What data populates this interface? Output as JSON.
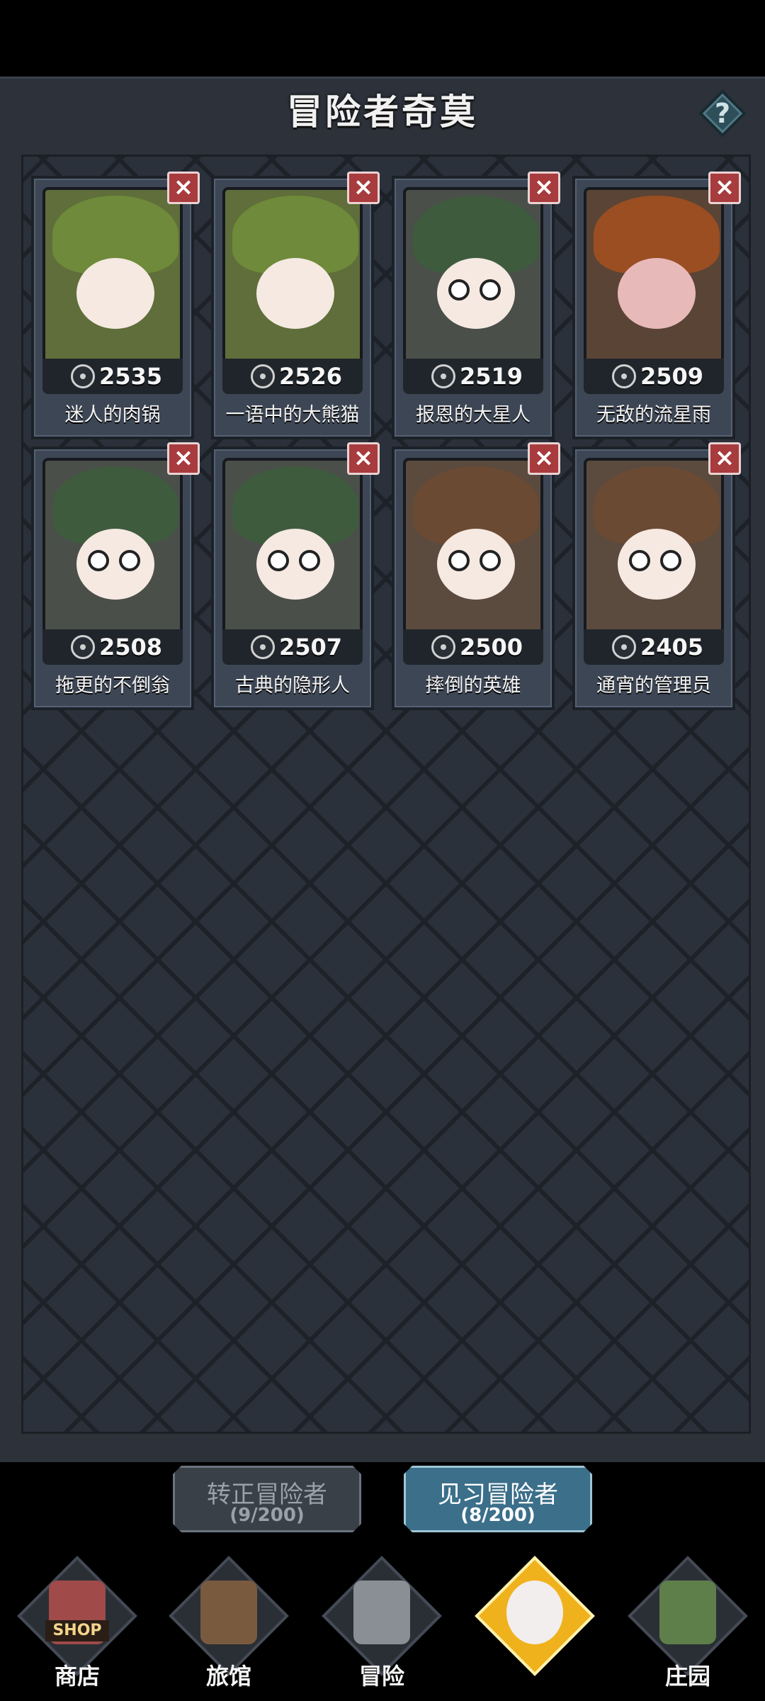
{
  "header": {
    "title": "冒险者奇莫",
    "help_label": "?"
  },
  "cards": [
    {
      "name": "迷人的肉锅",
      "score": "2535",
      "badge": "target-icon",
      "theme": "croc"
    },
    {
      "name": "一语中的大熊猫",
      "score": "2526",
      "badge": "target-icon",
      "theme": "croc"
    },
    {
      "name": "报恩的大星人",
      "score": "2519",
      "badge": "brush-icon",
      "theme": "girl"
    },
    {
      "name": "无敌的流星雨",
      "score": "2509",
      "badge": "target-icon",
      "theme": "pumpkin"
    },
    {
      "name": "拖更的不倒翁",
      "score": "2508",
      "badge": "target-icon",
      "theme": "girl"
    },
    {
      "name": "古典的隐形人",
      "score": "2507",
      "badge": "target-icon",
      "theme": "girl"
    },
    {
      "name": "摔倒的英雄",
      "score": "2500",
      "badge": "target-icon",
      "theme": "bear"
    },
    {
      "name": "通宵的管理员",
      "score": "2405",
      "badge": "brush-icon",
      "theme": "bear"
    }
  ],
  "close_label": "×",
  "tabs": [
    {
      "title": "转正冒险者",
      "count": "(9/200)"
    },
    {
      "title": "见习冒险者",
      "count": "(8/200)"
    }
  ],
  "nav": [
    {
      "label": "商店",
      "sign": "SHOP"
    },
    {
      "label": "旅馆"
    },
    {
      "label": "冒险"
    },
    {
      "label": ""
    },
    {
      "label": "庄园"
    }
  ],
  "colors": {
    "croc": "#6e8a3a",
    "girl": "#3f5b3e",
    "pumpkin": "#9a4e22",
    "bear": "#6b4a33"
  }
}
